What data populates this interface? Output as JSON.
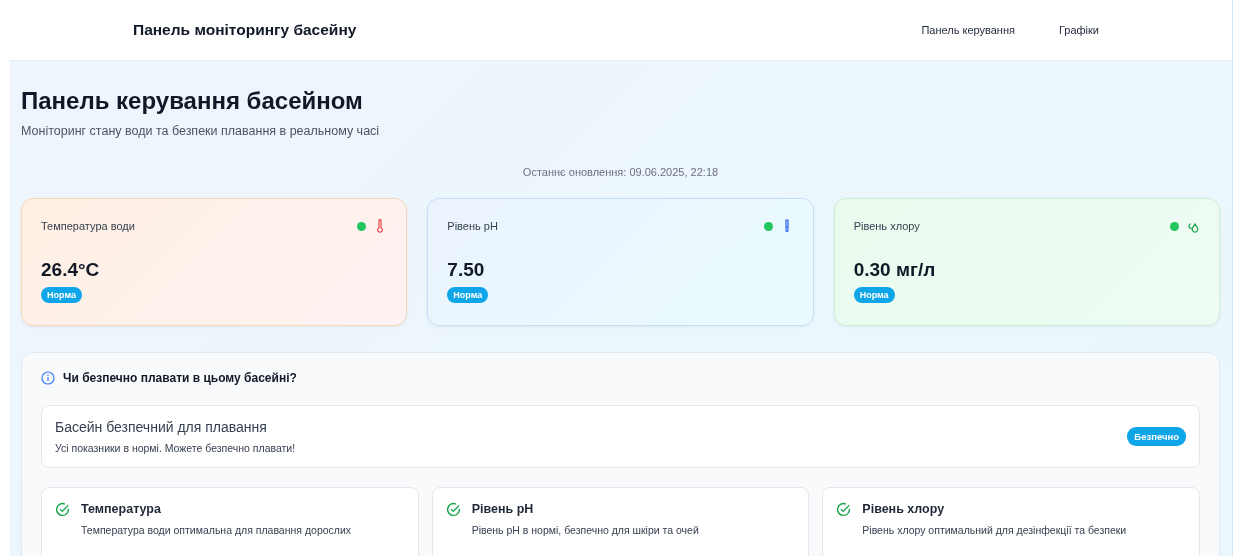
{
  "header": {
    "title": "Панель моніторингу басейну",
    "nav": [
      {
        "label": "Панель керування"
      },
      {
        "label": "Графіки"
      }
    ]
  },
  "page": {
    "title": "Панель керування басейном",
    "subtitle": "Моніторинг стану води та безпеки плавання в реальному часі",
    "last_update": "Останнє оновлення: 09.06.2025, 22:18"
  },
  "metrics": [
    {
      "kind": "temperature",
      "label": "Температура води",
      "value": "26.4°C",
      "status": "Норма",
      "color": "#22c55e"
    },
    {
      "kind": "ph",
      "label": "Рівень pH",
      "value": "7.50",
      "status": "Норма",
      "color": "#22c55e"
    },
    {
      "kind": "chlorine",
      "label": "Рівень хлору",
      "value": "0.30 мг/л",
      "status": "Норма",
      "color": "#22c55e"
    }
  ],
  "safety": {
    "question": "Чи безпечно плавати в цьому басейні?",
    "verdict": {
      "title": "Басейн безпечний для плавання",
      "text": "Усі показники в нормі. Можете безпечно плавати!",
      "badge": "Безпечно"
    },
    "checks": [
      {
        "ok": true,
        "title": "Температура",
        "text": "Температура води оптимальна для плавання дорослих"
      },
      {
        "ok": true,
        "title": "Рівень pH",
        "text": "Рівень pH в нормі, безпечно для шкіри та очей"
      },
      {
        "ok": true,
        "title": "Рівень хлору",
        "text": "Рівень хлору оптимальний для дезінфекції та безпеки"
      }
    ]
  }
}
